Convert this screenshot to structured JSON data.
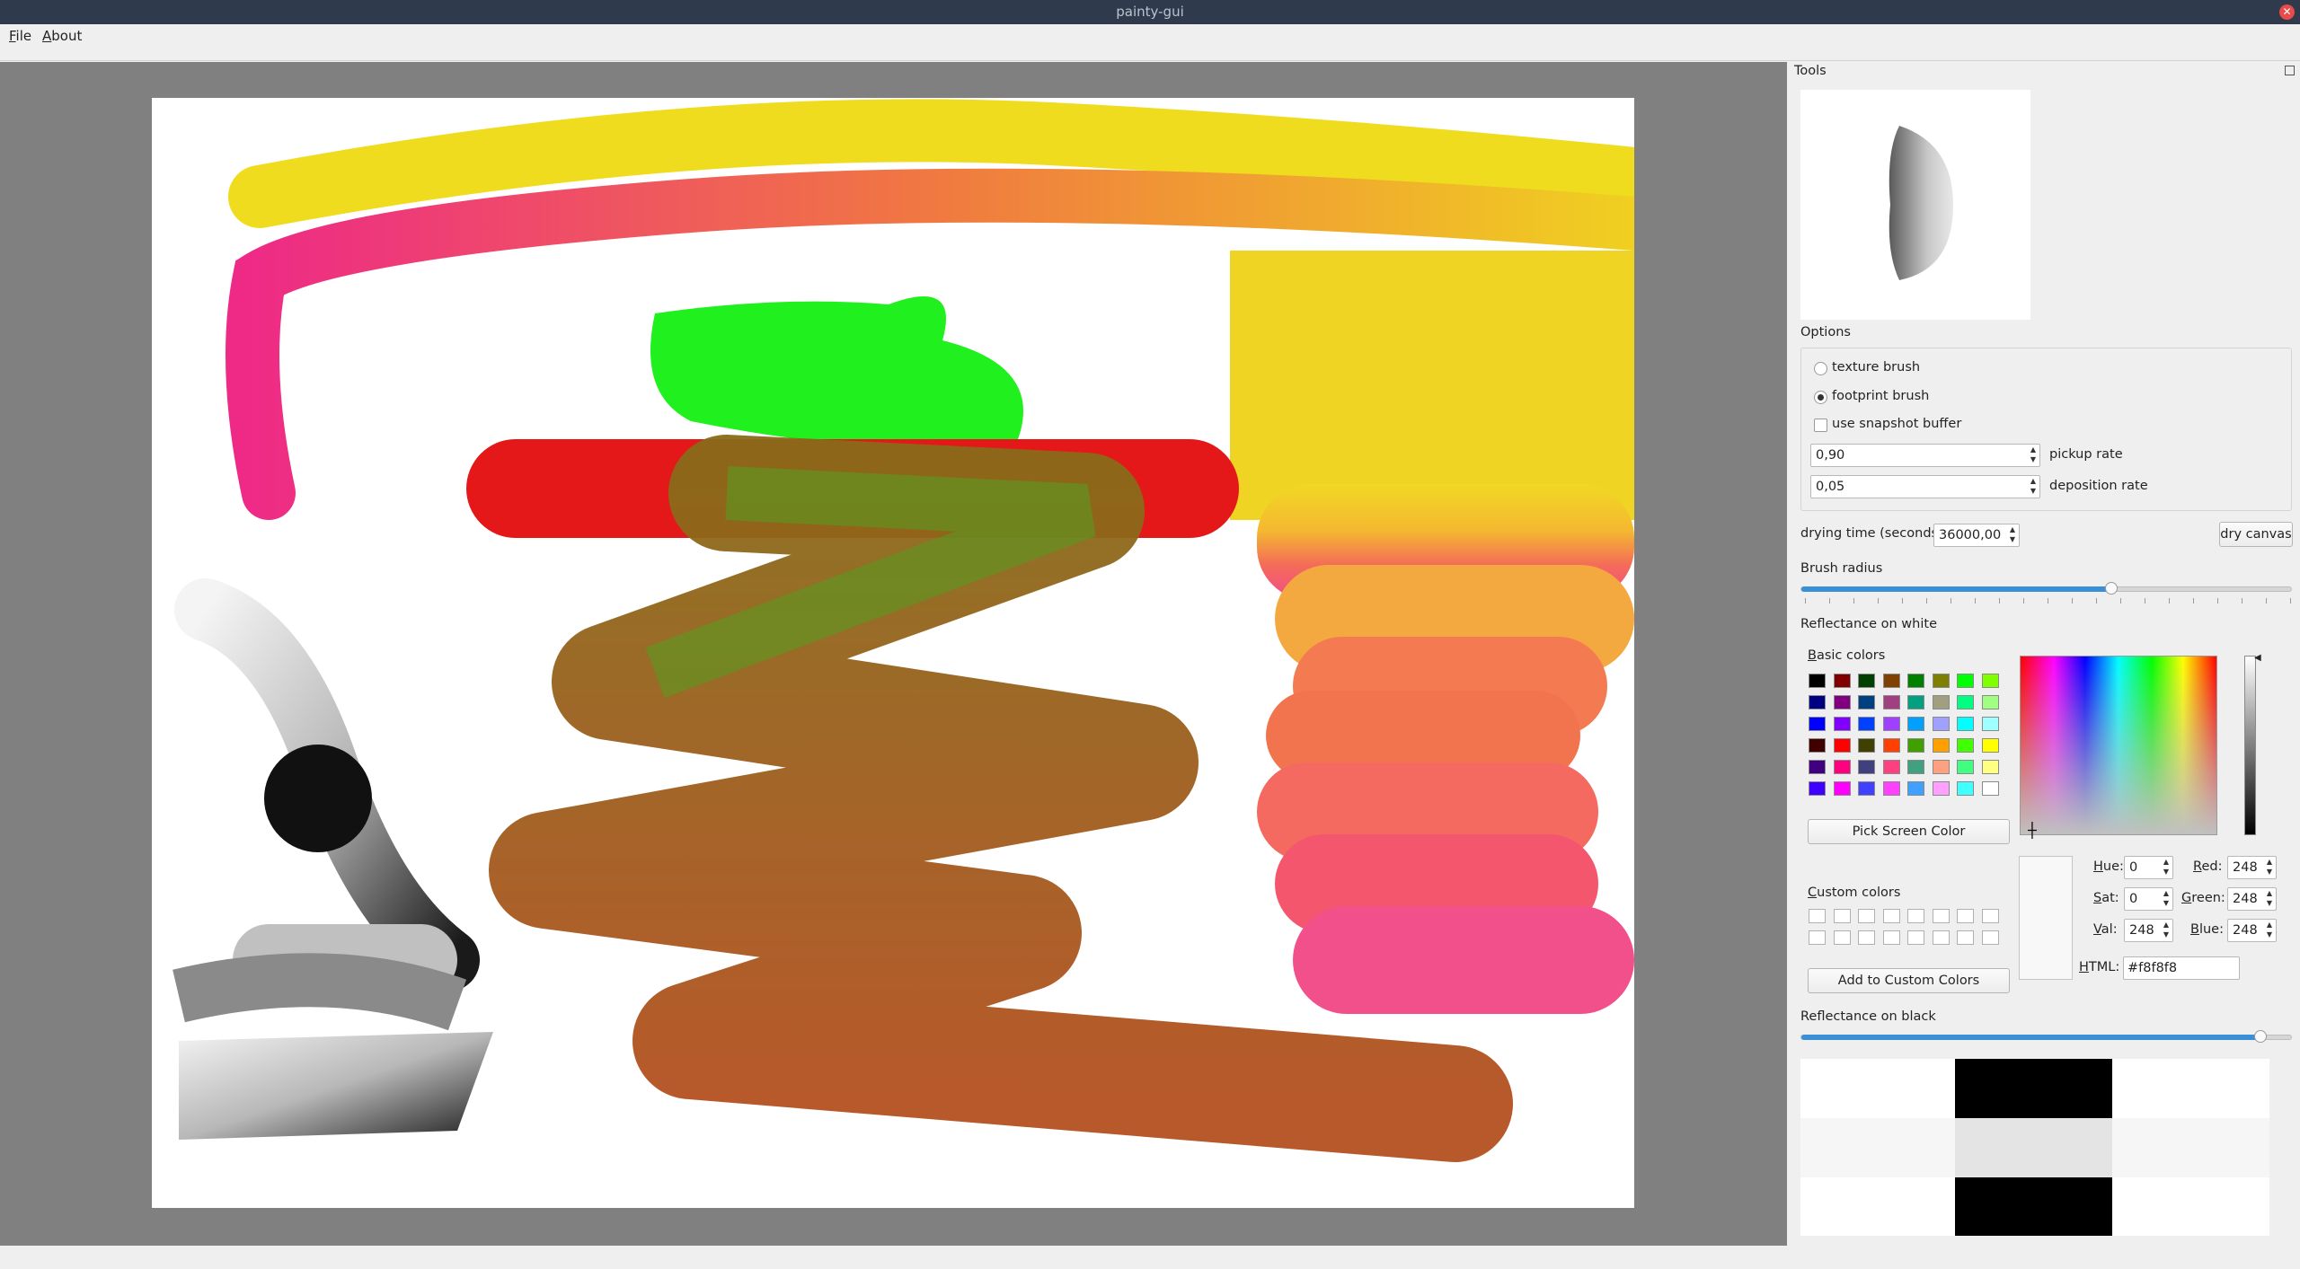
{
  "window": {
    "title": "painty-gui"
  },
  "menu": {
    "file": "File",
    "about": "About"
  },
  "dock": {
    "title": "Tools",
    "options_label": "Options",
    "texture_brush": "texture brush",
    "footprint_brush": "footprint brush",
    "use_snapshot": "use snapshot buffer",
    "pickup_value": "0,90",
    "pickup_label": "pickup rate",
    "deposition_value": "0,05",
    "deposition_label": "deposition rate",
    "drying_label": "drying time (seconds)",
    "drying_value": "36000,00",
    "dry_button": "dry canvas",
    "brush_radius_label": "Brush radius",
    "brush_radius_level": 0.63,
    "reflectance_white_label": "Reflectance on white",
    "basic_colors_label": "Basic colors",
    "pick_screen_color": "Pick Screen Color",
    "custom_colors_label": "Custom colors",
    "add_custom": "Add to Custom Colors",
    "hue_label": "Hue:",
    "hue": "0",
    "sat_label": "Sat:",
    "sat": "0",
    "val_label": "Val:",
    "val": "248",
    "red_label": "Red:",
    "red": "248",
    "green_label": "Green:",
    "green": "248",
    "blue_label": "Blue:",
    "blue": "248",
    "html_label": "HTML:",
    "html": "#f8f8f8",
    "reflectance_black_label": "Reflectance on black",
    "reflectance_black_level": 0.93
  },
  "basic_colors": [
    [
      "#000000",
      "#800000",
      "#004000",
      "#804000",
      "#008000",
      "#808000",
      "#00ff00",
      "#80ff00"
    ],
    [
      "#000080",
      "#800080",
      "#004080",
      "#a04080",
      "#00a080",
      "#a0a080",
      "#00ff80",
      "#a0ff80"
    ],
    [
      "#0000ff",
      "#8000ff",
      "#0040ff",
      "#a040ff",
      "#00a0ff",
      "#a0a0ff",
      "#00ffff",
      "#a0ffff"
    ],
    [
      "#400000",
      "#ff0000",
      "#404000",
      "#ff4000",
      "#40a000",
      "#ffa000",
      "#40ff00",
      "#ffff00"
    ],
    [
      "#400080",
      "#ff0080",
      "#404080",
      "#ff4080",
      "#40a080",
      "#ffa080",
      "#40ff80",
      "#ffff80"
    ],
    [
      "#4000ff",
      "#ff00ff",
      "#4040ff",
      "#ff40ff",
      "#40a0ff",
      "#ffa0ff",
      "#40ffff",
      "#ffffff"
    ]
  ]
}
